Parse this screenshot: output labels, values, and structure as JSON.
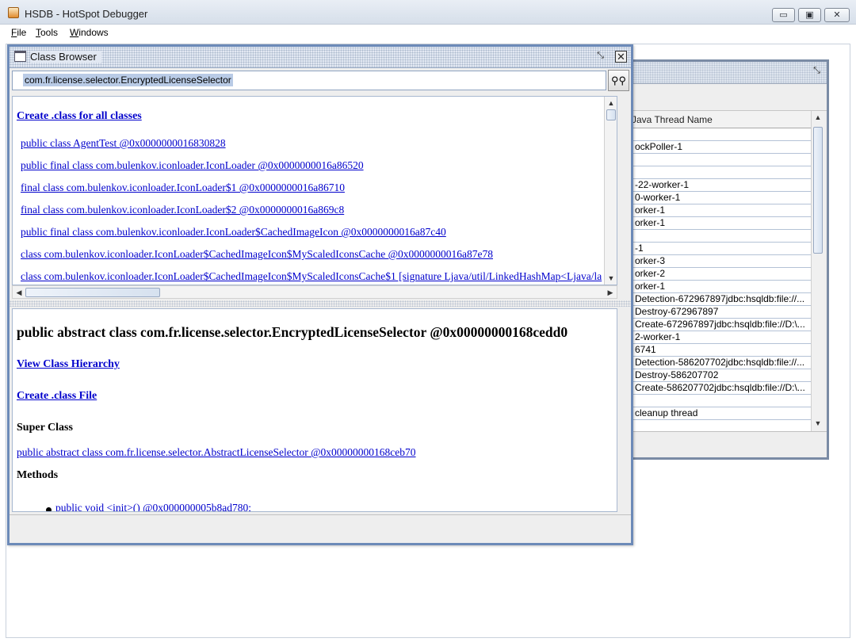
{
  "window": {
    "title": "HSDB - HotSpot Debugger",
    "controls": {
      "minimize": "▭",
      "maximize": "▣",
      "close": "✕"
    }
  },
  "menu": {
    "items": [
      "File",
      "Tools",
      "Windows"
    ]
  },
  "threads_frame": {
    "column_header": "Java Thread Name",
    "rows": [
      "",
      "ockPoller-1",
      "",
      "",
      "-22-worker-1",
      "0-worker-1",
      "orker-1",
      "orker-1",
      "",
      "-1",
      "orker-3",
      "orker-2",
      "orker-1",
      "Detection-672967897jdbc:hsqldb:file://...",
      "Destroy-672967897",
      "Create-672967897jdbc:hsqldb:file://D:\\...",
      "2-worker-1",
      "6741",
      "Detection-586207702jdbc:hsqldb:file://...",
      "Destroy-586207702",
      "Create-586207702jdbc:hsqldb:file://D:\\...",
      "",
      "cleanup thread"
    ]
  },
  "class_browser": {
    "title": "Class Browser",
    "search": {
      "value": "com.fr.license.selector.EncryptedLicenseSelector",
      "button_icon": "binoculars-icon"
    },
    "top": {
      "create_all_label": "Create .class for all classes",
      "classes": [
        "public class AgentTest @0x0000000016830828",
        "public final class com.bulenkov.iconloader.IconLoader @0x0000000016a86520",
        "final class com.bulenkov.iconloader.IconLoader$1 @0x0000000016a86710",
        "final class com.bulenkov.iconloader.IconLoader$2 @0x0000000016a869c8",
        "public final class com.bulenkov.iconloader.IconLoader$CachedImageIcon @0x0000000016a87c40",
        "class com.bulenkov.iconloader.IconLoader$CachedImageIcon$MyScaledIconsCache @0x0000000016a87e78",
        "class com.bulenkov.iconloader.IconLoader$CachedImageIcon$MyScaledIconsCache$1 [signature Ljava/util/LinkedHashMap<Ljava/la"
      ]
    },
    "detail": {
      "heading": "public abstract class com.fr.license.selector.EncryptedLicenseSelector @0x00000000168cedd0",
      "view_hierarchy_label": "View Class Hierarchy",
      "create_file_label": "Create .class File",
      "super_class_label": "Super Class",
      "super_class_value": "public abstract class com.fr.license.selector.AbstractLicenseSelector @0x00000000168ceb70",
      "methods_label": "Methods",
      "methods": [
        "public void <init>() @0x000000005b8ad780;"
      ]
    }
  }
}
